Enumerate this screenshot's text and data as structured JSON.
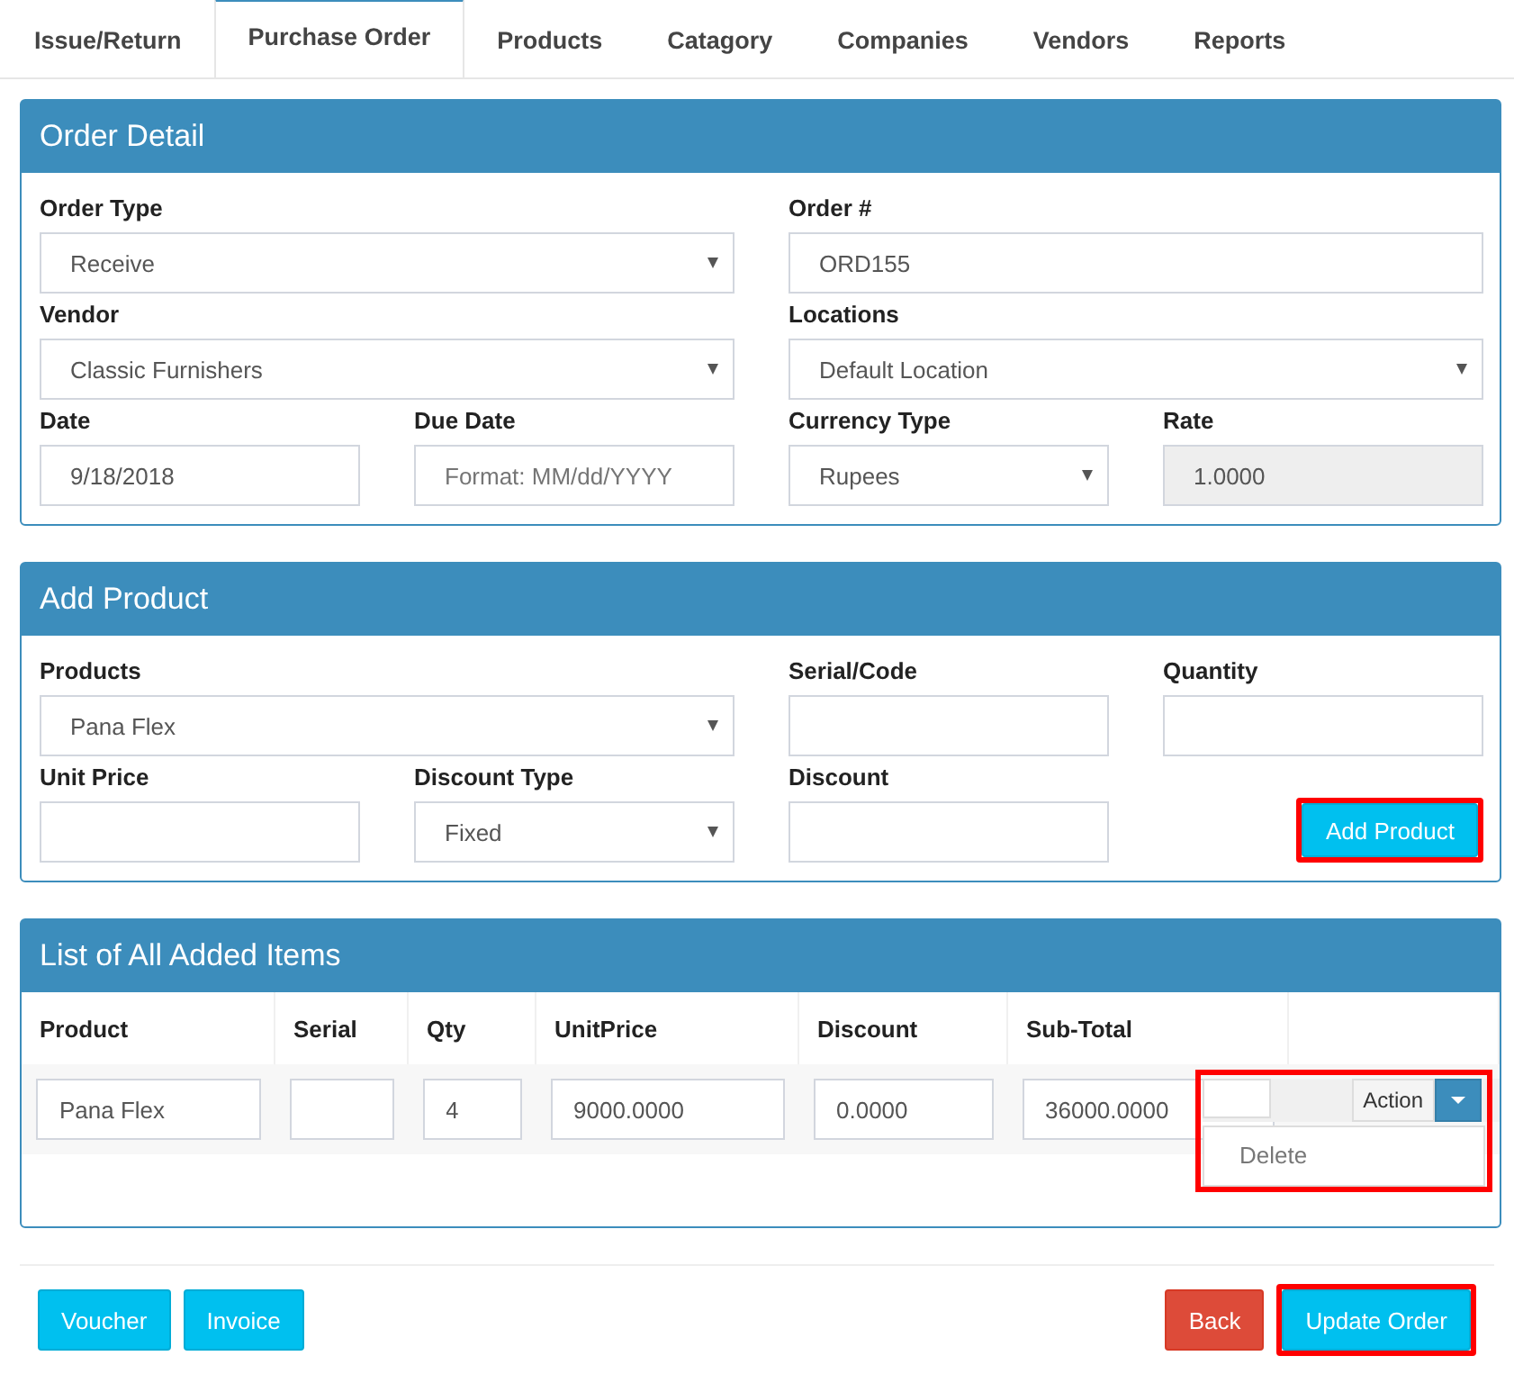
{
  "tabs": [
    {
      "label": "Issue/Return",
      "selected": false
    },
    {
      "label": "Purchase Order",
      "selected": true
    },
    {
      "label": "Products",
      "selected": false
    },
    {
      "label": "Catagory",
      "selected": false
    },
    {
      "label": "Companies",
      "selected": false
    },
    {
      "label": "Vendors",
      "selected": false
    },
    {
      "label": "Reports",
      "selected": false
    }
  ],
  "order_detail": {
    "title": "Order Detail",
    "fields": [
      {
        "label": "Order Type",
        "kind": "select",
        "value": "Receive",
        "wide": true
      },
      {
        "label": "Order #",
        "kind": "text",
        "value": "ORD155",
        "wide": true
      },
      {
        "label": "Vendor",
        "kind": "select",
        "value": "Classic Furnishers",
        "wide": true
      },
      {
        "label": "Locations",
        "kind": "select",
        "value": "Default Location",
        "wide": true
      },
      {
        "label": "Date",
        "kind": "text",
        "value": "9/18/2018",
        "wide": false
      },
      {
        "label": "Due Date",
        "kind": "text",
        "placeholder": "Format: MM/dd/YYYY",
        "wide": false
      },
      {
        "label": "Currency Type",
        "kind": "select",
        "value": "Rupees",
        "wide": false
      },
      {
        "label": "Rate",
        "kind": "disabled",
        "value": "1.0000",
        "wide": false
      }
    ]
  },
  "add_product": {
    "title": "Add Product",
    "fields": [
      {
        "label": "Products",
        "kind": "select",
        "value": "Pana Flex",
        "wide": true
      },
      {
        "label": "Serial/Code",
        "kind": "text",
        "wide": false
      },
      {
        "label": "Quantity",
        "kind": "text",
        "wide": false
      },
      {
        "label": "Unit Price",
        "kind": "text",
        "wide": false
      },
      {
        "label": "Discount Type",
        "kind": "select",
        "value": "Fixed",
        "wide": false
      },
      {
        "label": "Discount",
        "kind": "text",
        "wide": false
      },
      {
        "kind": "button",
        "value": "Add Product",
        "highlighted": true
      }
    ]
  },
  "items": {
    "title": "List of All Added Items",
    "columns": [
      "Product",
      "Serial",
      "Qty",
      "UnitPrice",
      "Discount",
      "Sub-Total"
    ],
    "rows": [
      {
        "cells": [
          "Pana Flex",
          null,
          "4",
          "9000.0000",
          "0.0000",
          "36000.0000"
        ],
        "action": {
          "label": "Action",
          "menu": [
            "Delete"
          ],
          "highlighted": true
        }
      }
    ]
  },
  "footer": {
    "left": [
      {
        "label": "Voucher",
        "kind": "info",
        "highlighted": false
      },
      {
        "label": "Invoice",
        "kind": "info",
        "highlighted": false
      }
    ],
    "right": [
      {
        "label": "Back",
        "kind": "danger",
        "highlighted": false
      },
      {
        "label": "Update Order",
        "kind": "info",
        "highlighted": true
      }
    ]
  }
}
